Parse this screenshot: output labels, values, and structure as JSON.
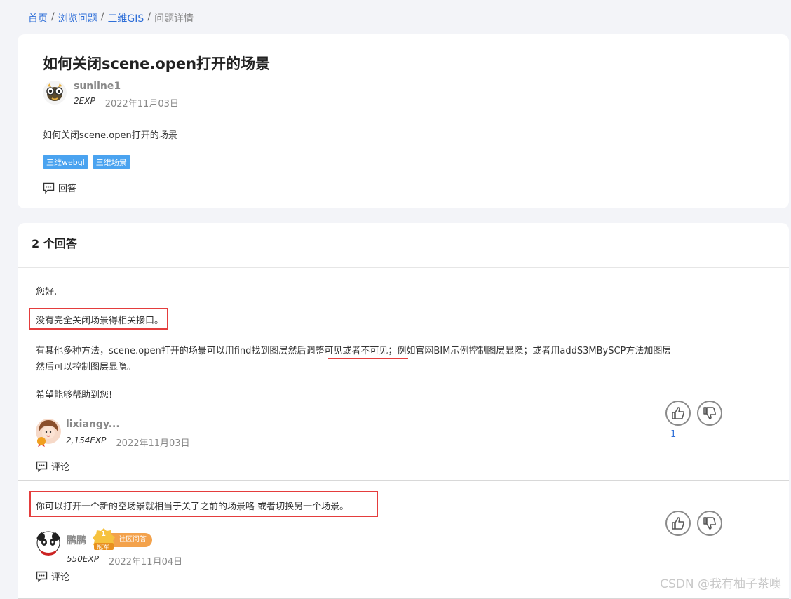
{
  "breadcrumb": {
    "home": "首页",
    "browse": "浏览问题",
    "category": "三维GIS",
    "current": "问题详情",
    "separator": "/"
  },
  "question": {
    "title": "如何关闭scene.open打开的场景",
    "author": "sunline1",
    "exp": "2EXP",
    "date": "2022年11月03日",
    "body": "如何关闭scene.open打开的场景",
    "tags": [
      "三维webgl",
      "三维场景"
    ],
    "answer_label": "回答"
  },
  "answers_header": "2 个回答",
  "answers": [
    {
      "lines": [
        "您好,",
        "没有完全关闭场景得相关接口。",
        "有其他多种方法，scene.open打开的场景可以用find找到图层然后调整可见或者不可见；例如官网BIM示例控制图层显隐；或者用addS3MBySCP方法加图层",
        "然后可以控制图层显隐。",
        "希望能够帮助到您!"
      ],
      "author": "lixiangy...",
      "exp": "2,154EXP",
      "date": "2022年11月03日",
      "like_count": "1",
      "comment_label": "评论"
    },
    {
      "lines": [
        "你可以打开一个新的空场景就相当于关了之前的场景咯 或者切换另一个场景。"
      ],
      "author": "鹏鹏",
      "badge_rank": "1",
      "badge_title": "冠军",
      "badge_label": "社区问答",
      "exp": "550EXP",
      "date": "2022年11月04日",
      "comment_label": "评论"
    }
  ],
  "watermark": "CSDN @我有柚子茶噢",
  "colors": {
    "link": "#2f6fd8",
    "tag": "#4aa3f0",
    "highlight": "#e43d3d",
    "badge": "#f3a24c"
  }
}
